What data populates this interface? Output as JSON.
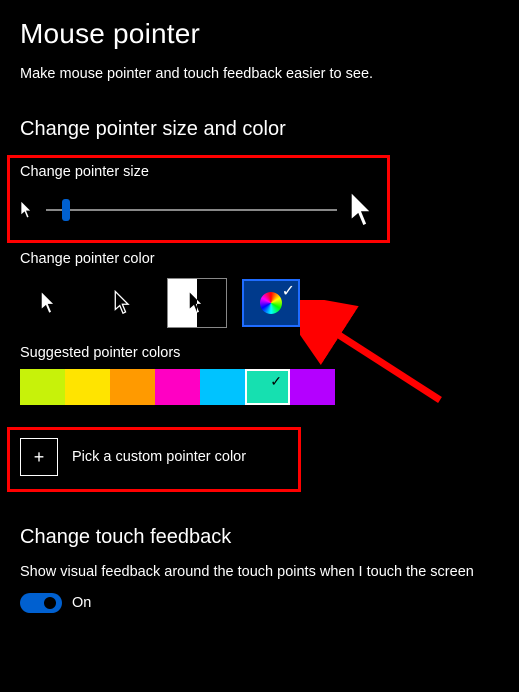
{
  "title": "Mouse pointer",
  "subtitle": "Make mouse pointer and touch feedback easier to see.",
  "section_size_color": "Change pointer size and color",
  "pointer_size_label": "Change pointer size",
  "pointer_color_label": "Change pointer color",
  "suggested_label": "Suggested pointer colors",
  "custom_color_label": "Pick a custom pointer color",
  "touch_section_title": "Change touch feedback",
  "touch_text": "Show visual feedback around the touch points when I touch the screen",
  "toggle_state_label": "On",
  "suggested_colors": [
    "#c7f20a",
    "#ffe400",
    "#ff9a00",
    "#ff00c3",
    "#00c3ff",
    "#16e0b0",
    "#b400ff"
  ],
  "suggested_selected_index": 5
}
